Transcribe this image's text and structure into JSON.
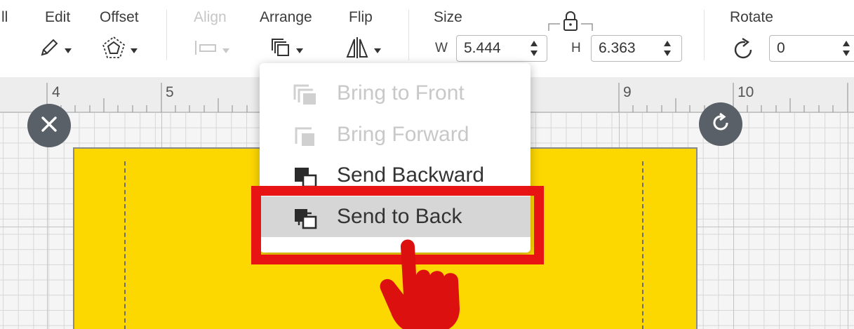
{
  "toolbar": {
    "partial_left_label": "ll",
    "edit": {
      "label": "Edit"
    },
    "offset": {
      "label": "Offset"
    },
    "align": {
      "label": "Align"
    },
    "arrange": {
      "label": "Arrange"
    },
    "flip": {
      "label": "Flip"
    },
    "size": {
      "label": "Size",
      "w_label": "W",
      "w_value": "5.444",
      "h_label": "H",
      "h_value": "6.363"
    },
    "rotate": {
      "label": "Rotate",
      "value": "0"
    }
  },
  "ruler": {
    "numbers": [
      "4",
      "5",
      "9",
      "10"
    ]
  },
  "arrange_menu": {
    "items": [
      {
        "label": "Bring to Front",
        "enabled": false
      },
      {
        "label": "Bring Forward",
        "enabled": false
      },
      {
        "label": "Send Backward",
        "enabled": true
      },
      {
        "label": "Send to Back",
        "enabled": true,
        "highlighted": true
      }
    ]
  },
  "colors": {
    "shape_fill": "#fdd700",
    "highlight_box": "#e81414",
    "pointer": "#dd1010",
    "handle": "#5a6067"
  },
  "icons": [
    "pencil-icon",
    "offset-icon",
    "align-icon",
    "arrange-icon",
    "flip-icon",
    "lock-icon",
    "rotate-icon",
    "close-icon",
    "rotate-handle-icon",
    "pointer-hand-icon"
  ]
}
